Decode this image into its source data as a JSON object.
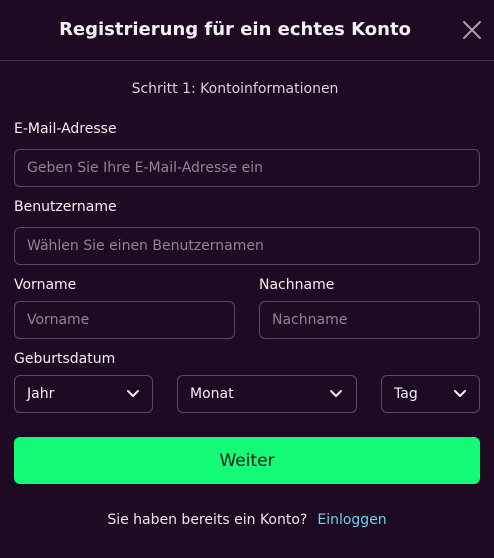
{
  "header": {
    "title": "Registrierung für ein echtes Konto"
  },
  "step_text": "Schritt 1: Kontoinformationen",
  "form": {
    "email": {
      "label": "E-Mail-Adresse",
      "placeholder": "Geben Sie Ihre E-Mail-Adresse ein",
      "value": ""
    },
    "username": {
      "label": "Benutzername",
      "placeholder": "Wählen Sie einen Benutzernamen",
      "value": ""
    },
    "first_name": {
      "label": "Vorname",
      "placeholder": "Vorname",
      "value": ""
    },
    "last_name": {
      "label": "Nachname",
      "placeholder": "Nachname",
      "value": ""
    },
    "birthdate": {
      "label": "Geburtsdatum",
      "year": "Jahr",
      "month": "Monat",
      "day": "Tag"
    },
    "submit_label": "Weiter"
  },
  "footer": {
    "question": "Sie haben bereits ein Konto?",
    "login_link": "Einloggen"
  },
  "colors": {
    "background": "#1e0a22",
    "accent": "#14fb78",
    "link": "#6fd3e6",
    "border": "#5a4a60"
  },
  "icons": {
    "close": "close-icon",
    "dropdown": "chevron-down-icon"
  }
}
